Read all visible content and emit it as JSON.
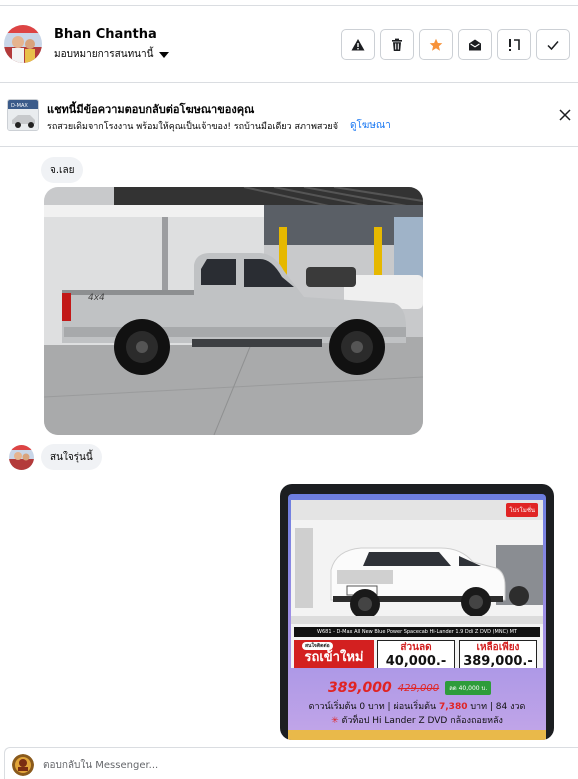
{
  "header": {
    "name": "Bhan Chantha",
    "assign_label": "มอบหมายการสนทนานี้",
    "actions": [
      {
        "name": "report-spam-button",
        "icon": "warning-icon"
      },
      {
        "name": "delete-button",
        "icon": "trash-icon"
      },
      {
        "name": "star-button",
        "icon": "star-icon"
      },
      {
        "name": "mark-unread-button",
        "icon": "envelope-open-icon"
      },
      {
        "name": "follow-up-button",
        "icon": "exclamation-icon"
      },
      {
        "name": "mark-done-button",
        "icon": "check-icon"
      }
    ],
    "star_color": "#f7923a"
  },
  "ad_banner": {
    "title": "แชทนี้มีข้อความตอบกลับต่อโฆษณาของคุณ",
    "description": "รถสวยเดิมจากโรงงาน พร้อมให้คุณเป็นเจ้าของ! รถบ้านมือเดียว สภาพสวยจั",
    "view_ad_link": "ดูโฆษณา",
    "thumb_text": "D-MAX"
  },
  "messages": {
    "m1_text": "จ.เลย",
    "m2_text": "สนใจรุ่นนี้"
  },
  "promo": {
    "badge": "โปรโมชั่น",
    "model_bar": "W681 - D-Max All New Blue Power Spacecab Hi-Lander 1.9 Ddi Z DVD (MNC) MT",
    "new_car_tag": "สนใจติดต่อ",
    "new_car": "รถเข้าใหม่",
    "discount_label": "ส่วนลด",
    "discount_value": "40,000.-",
    "remaining_label": "เหลือเพียง",
    "remaining_value": "389,000.-",
    "plate": "ป้ายแดง",
    "price_now": "389,000",
    "price_old": "429,000",
    "save_tag": "ลด 40,000 บ.",
    "line1_pre": "ดาวน์เริ่มต้น 0 บาท | ผ่อนเริ่มต้น ",
    "line1_red": "7,380",
    "line1_post": " บาท | 84 งวด",
    "line2_star": "✳",
    "line2": " ตัวท็อป Hi Lander Z DVD กล้องถอยหลัง"
  },
  "composer": {
    "placeholder": "ตอบกลับใน Messenger..."
  }
}
